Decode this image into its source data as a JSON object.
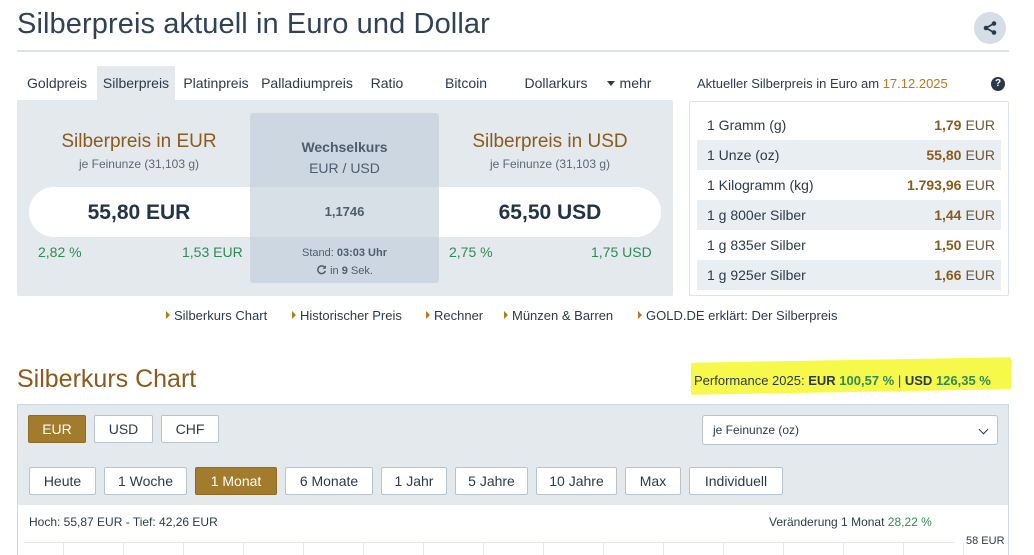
{
  "header": {
    "title": "Silberpreis aktuell in Euro und Dollar",
    "share_icon": "share-icon"
  },
  "tabs": [
    {
      "label": "Goldpreis",
      "active": false
    },
    {
      "label": "Silberpreis",
      "active": true
    },
    {
      "label": "Platinpreis",
      "active": false
    },
    {
      "label": "Palladiumpreis",
      "active": false
    },
    {
      "label": "Ratio",
      "active": false
    },
    {
      "label": "Bitcoin",
      "active": false
    },
    {
      "label": "Dollarkurs",
      "active": false
    },
    {
      "label": "mehr",
      "active": false
    }
  ],
  "price": {
    "eur": {
      "title": "Silberpreis in EUR",
      "sub": "je Feinunze (31,103 g)",
      "value": "55,80 EUR",
      "change_pct": "2,82 %",
      "change_abs": "1,53 EUR"
    },
    "usd": {
      "title": "Silberpreis in USD",
      "sub": "je Feinunze (31,103 g)",
      "value": "65,50 USD",
      "change_pct": "2,75 %",
      "change_abs": "1,75 USD"
    },
    "fx": {
      "title": "Wechselkurs",
      "pair": "EUR / USD",
      "rate": "1,1746",
      "stand_label": "Stand:",
      "stand_time": "03:03 Uhr",
      "refresh_prefix": "in",
      "refresh_seconds": "9",
      "refresh_suffix": "Sek."
    }
  },
  "side": {
    "heading": "Aktueller Silberpreis in Euro am",
    "date": "17.12.2025",
    "rows": [
      {
        "label": "1 Gramm (g)",
        "value": "1,79",
        "cur": "EUR"
      },
      {
        "label": "1 Unze (oz)",
        "value": "55,80",
        "cur": "EUR"
      },
      {
        "label": "1 Kilogramm (kg)",
        "value": "1.793,96",
        "cur": "EUR"
      },
      {
        "label": "1 g 800er Silber",
        "value": "1,44",
        "cur": "EUR"
      },
      {
        "label": "1 g 835er Silber",
        "value": "1,50",
        "cur": "EUR"
      },
      {
        "label": "1 g 925er Silber",
        "value": "1,66",
        "cur": "EUR"
      }
    ]
  },
  "links": [
    {
      "label": "Silberkurs Chart"
    },
    {
      "label": "Historischer Preis"
    },
    {
      "label": "Rechner"
    },
    {
      "label": "Münzen & Barren"
    },
    {
      "label": "GOLD.DE erklärt: Der Silberpreis"
    }
  ],
  "chart": {
    "title": "Silberkurs Chart",
    "perf_label": "Performance 2025:",
    "perf_eur_label": "EUR",
    "perf_eur": "100,57 %",
    "perf_sep": "|",
    "perf_usd_label": "USD",
    "perf_usd": "126,35 %",
    "currencies": [
      {
        "label": "EUR",
        "active": true
      },
      {
        "label": "USD",
        "active": false
      },
      {
        "label": "CHF",
        "active": false
      }
    ],
    "unit_select": "je Feinunze (oz)",
    "ranges": [
      {
        "label": "Heute",
        "active": false
      },
      {
        "label": "1 Woche",
        "active": false
      },
      {
        "label": "1 Monat",
        "active": true
      },
      {
        "label": "6 Monate",
        "active": false
      },
      {
        "label": "1 Jahr",
        "active": false
      },
      {
        "label": "5 Jahre",
        "active": false
      },
      {
        "label": "10 Jahre",
        "active": false
      },
      {
        "label": "Max",
        "active": false
      },
      {
        "label": "Individuell",
        "active": false
      }
    ],
    "high_low": "Hoch: 55,87 EUR - Tief: 42,26 EUR",
    "change_label": "Veränderung 1 Monat",
    "change_value": "28,22 %",
    "y_tick": "58 EUR"
  },
  "colors": {
    "accent_brown": "#8b5a1c",
    "active_button": "#a27b2c",
    "positive": "#2f8a55",
    "highlight": "#f6f94a",
    "panel_bg": "#e4e9ee"
  }
}
